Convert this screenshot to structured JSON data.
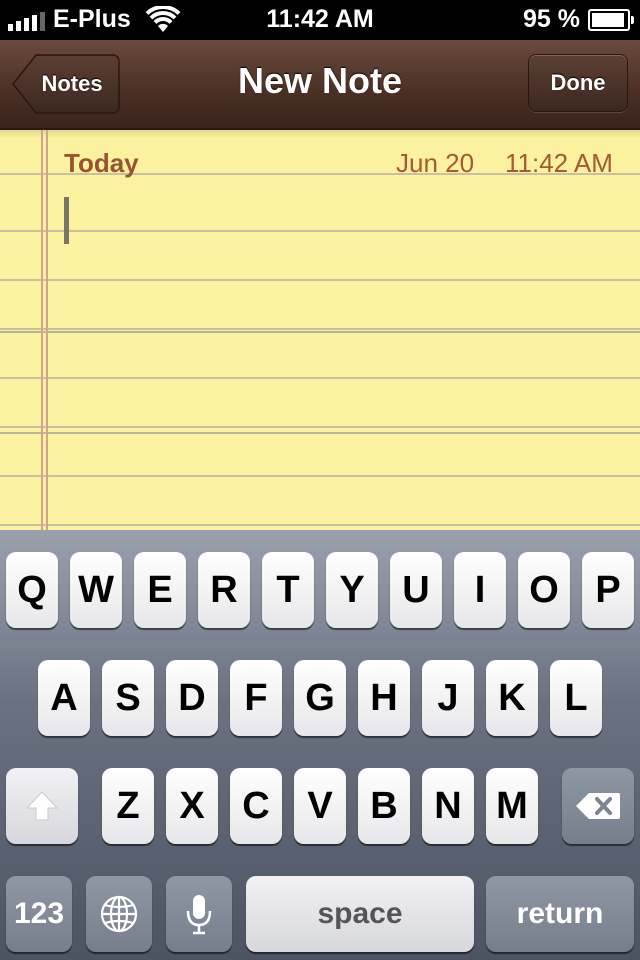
{
  "status_bar": {
    "carrier": "E-Plus",
    "time": "11:42 AM",
    "battery_percent": "95 %",
    "battery_level": 0.95,
    "signal_bars": 4
  },
  "nav": {
    "title": "New Note",
    "back_label": "Notes",
    "done_label": "Done"
  },
  "note": {
    "day_label": "Today",
    "date": "Jun 20",
    "time": "11:42 AM",
    "body": ""
  },
  "keyboard": {
    "row1": [
      "Q",
      "W",
      "E",
      "R",
      "T",
      "Y",
      "U",
      "I",
      "O",
      "P"
    ],
    "row2": [
      "A",
      "S",
      "D",
      "F",
      "G",
      "H",
      "J",
      "K",
      "L"
    ],
    "row3": [
      "Z",
      "X",
      "C",
      "V",
      "B",
      "N",
      "M"
    ],
    "numbers_label": "123",
    "space_label": "space",
    "return_label": "return",
    "icons": {
      "shift": "shift-arrow-icon",
      "delete": "backspace-icon",
      "globe": "globe-icon",
      "mic": "microphone-icon"
    }
  },
  "colors": {
    "nav_leather": "#4a2f25",
    "paper_yellow": "#fbf19e",
    "note_header_text": "#a55a35"
  }
}
